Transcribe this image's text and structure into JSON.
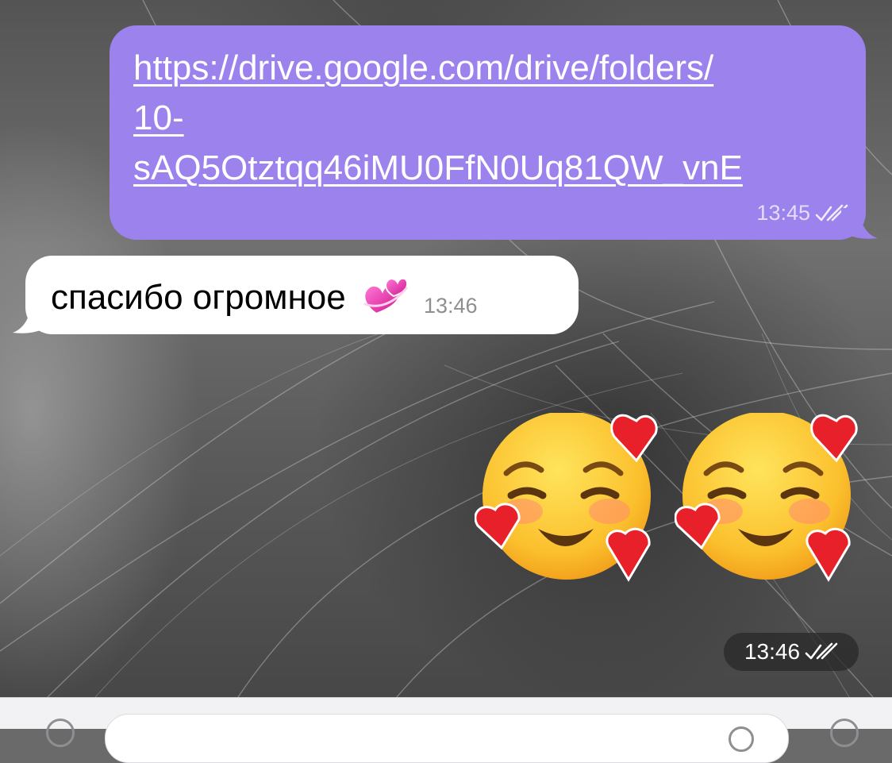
{
  "outgoing_message": {
    "link_lines": [
      "https://drive.google.com/drive/folders/",
      "10-",
      "sAQ5Otztqq46iMU0FfN0Uq81QW_vnE"
    ],
    "time": "13:45",
    "status_icon": "double-check-icon"
  },
  "incoming_message": {
    "text": "спасибо огромное",
    "emoji": "two-hearts-emoji",
    "time": "13:46"
  },
  "emoji_message": {
    "emojis": [
      "smiling-face-with-hearts-emoji",
      "smiling-face-with-hearts-emoji"
    ],
    "time": "13:46",
    "status_icon": "double-check-icon"
  },
  "input_bar": {
    "left_icon": "attach-icon",
    "inner_icon": "sticker-icon",
    "right_icon": "microphone-icon"
  },
  "colors": {
    "outgoing_bubble": "#9c82ec",
    "incoming_bubble": "#ffffff",
    "time_pill": "#282828"
  }
}
